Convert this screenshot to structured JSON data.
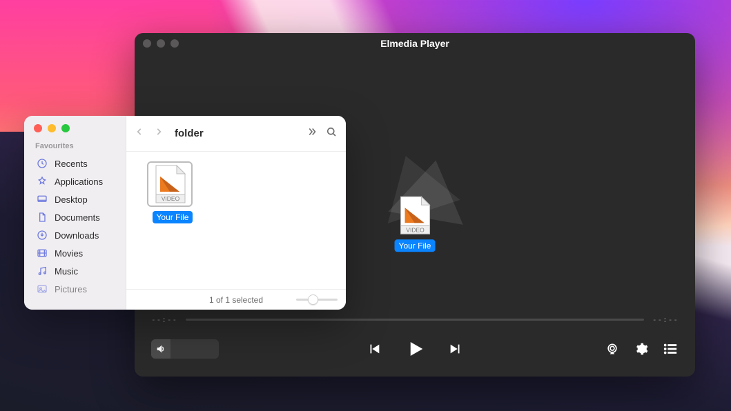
{
  "player": {
    "title": "Elmedia Player",
    "time_elapsed": "--:--",
    "time_remaining": "--:--",
    "drag_file_label": "Your File",
    "drag_file_type": "VIDEO"
  },
  "finder": {
    "folder_title": "folder",
    "sidebar_section": "Favourites",
    "sidebar": {
      "items": [
        {
          "icon": "clock-icon",
          "label": "Recents"
        },
        {
          "icon": "apps-icon",
          "label": "Applications"
        },
        {
          "icon": "desktop-icon",
          "label": "Desktop"
        },
        {
          "icon": "document-icon",
          "label": "Documents"
        },
        {
          "icon": "download-icon",
          "label": "Downloads"
        },
        {
          "icon": "movies-icon",
          "label": "Movies"
        },
        {
          "icon": "music-icon",
          "label": "Music"
        },
        {
          "icon": "pictures-icon",
          "label": "Pictures"
        }
      ]
    },
    "file_label": "Your File",
    "file_type": "VIDEO",
    "status_text": "1 of 1 selected"
  }
}
